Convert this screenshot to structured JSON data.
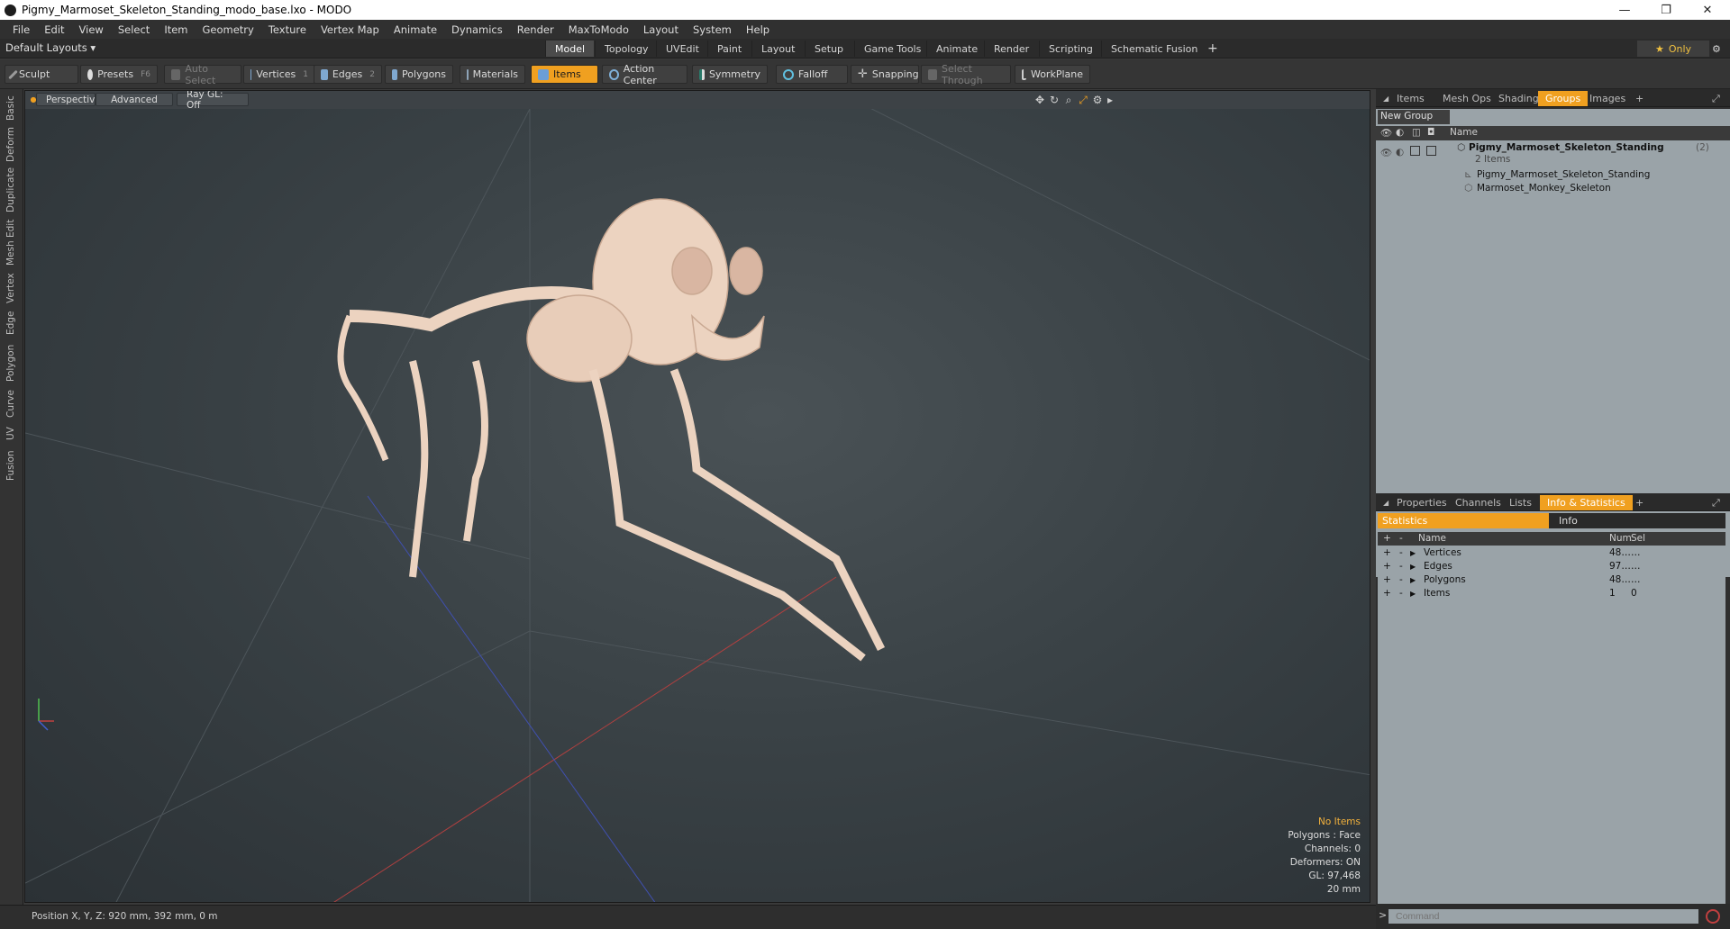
{
  "window": {
    "title": "Pigmy_Marmoset_Skeleton_Standing_modo_base.lxo - MODO",
    "min": "—",
    "max": "❐",
    "close": "✕"
  },
  "menu": [
    "File",
    "Edit",
    "View",
    "Select",
    "Item",
    "Geometry",
    "Texture",
    "Vertex Map",
    "Animate",
    "Dynamics",
    "Render",
    "MaxToModo",
    "Layout",
    "System",
    "Help"
  ],
  "layoutbar": {
    "layouts": "Default Layouts ▾",
    "tabs": [
      "Model",
      "Topology",
      "UVEdit",
      "Paint",
      "Layout",
      "Setup",
      "Game Tools",
      "Animate",
      "Render",
      "Scripting",
      "Schematic Fusion"
    ],
    "active_tab": "Model",
    "add": "+",
    "only": "Only"
  },
  "toolbar": {
    "sculpt": "Sculpt",
    "presets": "Presets",
    "presets_key": "F6",
    "auto_select": "Auto Select",
    "vertices": "Vertices",
    "vertices_n": "1",
    "edges": "Edges",
    "edges_n": "2",
    "polygons": "Polygons",
    "materials": "Materials",
    "items": "Items",
    "action_center": "Action Center",
    "symmetry": "Symmetry",
    "falloff": "Falloff",
    "snapping": "Snapping",
    "select_through": "Select Through",
    "workplane": "WorkPlane"
  },
  "left_tabs": [
    "Basic",
    "Deform",
    "Duplicate",
    "Mesh Edit",
    "Vertex",
    "Edge",
    "Polygon",
    "Curve",
    "UV",
    "Fusion"
  ],
  "viewport": {
    "perspective": "Perspective",
    "advanced": "Advanced",
    "raygl": "Ray GL: Off",
    "info": {
      "no_items": "No Items",
      "polygons": "Polygons : Face",
      "channels": "Channels: 0",
      "deformers": "Deformers: ON",
      "gl": "GL: 97,468",
      "size": "20 mm"
    }
  },
  "status": {
    "position": "Position X, Y, Z:  920 mm, 392 mm, 0 m"
  },
  "right_top_tabs": [
    "Items",
    "Mesh Ops",
    "Shading",
    "Groups",
    "Images"
  ],
  "right_top_active": "Groups",
  "groups": {
    "new_group": "New Group",
    "col_name": "Name",
    "root": "Pigmy_Marmoset_Skeleton_Standing",
    "root_count": "(2)",
    "root_sub": "2 Items",
    "children": [
      "Pigmy_Marmoset_Skeleton_Standing",
      "Marmoset_Monkey_Skeleton"
    ]
  },
  "right_bottom_tabs": [
    "Properties",
    "Channels",
    "Lists",
    "Info & Statistics"
  ],
  "right_bottom_active": "Info & Statistics",
  "stats": {
    "tab_statistics": "Statistics",
    "tab_info": "Info",
    "cols": {
      "name": "Name",
      "num": "Num",
      "sel": "Sel"
    },
    "rows": [
      {
        "name": "Vertices",
        "num": "48…",
        "sel": "…"
      },
      {
        "name": "Edges",
        "num": "97…",
        "sel": "…"
      },
      {
        "name": "Polygons",
        "num": "48…",
        "sel": "…"
      },
      {
        "name": "Items",
        "num": "1",
        "sel": "0"
      }
    ]
  },
  "command": {
    "placeholder": "Command"
  }
}
